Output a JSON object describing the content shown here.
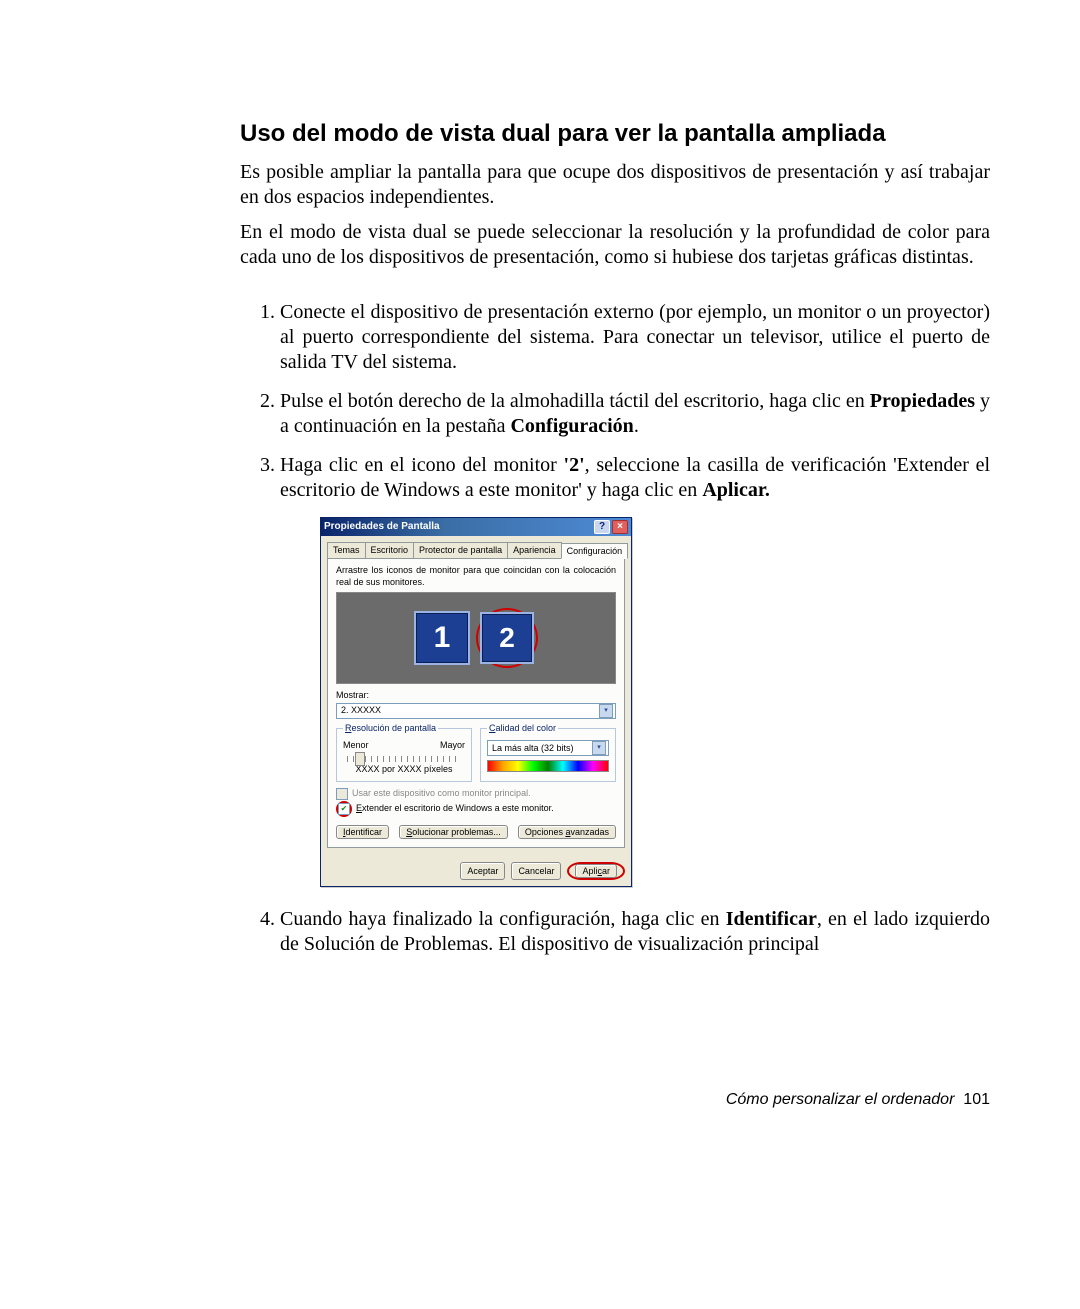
{
  "section_title": "Uso del modo de vista dual para ver la pantalla ampliada",
  "intro_p1": "Es posible ampliar la pantalla para que ocupe dos dispositivos de presentación y así trabajar en dos espacios independientes.",
  "intro_p2": "En el modo de vista dual se puede seleccionar la resolución y la profundidad de color para cada uno de los dispositivos de presentación, como si hubiese dos tarjetas gráficas distintas.",
  "steps": {
    "s1": "Conecte el dispositivo de presentación externo (por ejemplo, un monitor o un proyector) al puerto correspondiente del sistema. Para conectar un televisor, utilice el puerto de salida TV del sistema.",
    "s2_a": "Pulse el botón derecho de la almohadilla táctil del escritorio, haga clic en ",
    "s2_b1": "Propiedades",
    "s2_c": " y a continuación en la pestaña ",
    "s2_b2": "Configuración",
    "s2_d": ".",
    "s3_a": "Haga clic en el icono del monitor ",
    "s3_b1": "'2'",
    "s3_c": ", seleccione la casilla de verificación 'Extender el escritorio de Windows a este monitor' y haga clic en ",
    "s3_b2": "Aplicar.",
    "s4_a": "Cuando haya finalizado la configuración, haga clic en ",
    "s4_b1": "Identificar",
    "s4_c": ", en el lado izquierdo de Solución de Problemas. El dispositivo de visualización principal"
  },
  "dialog": {
    "title": "Propiedades de Pantalla",
    "help": "?",
    "close": "×",
    "tabs": [
      "Temas",
      "Escritorio",
      "Protector de pantalla",
      "Apariencia",
      "Configuración"
    ],
    "active_tab_index": 4,
    "hint": "Arrastre los iconos de monitor para que coincidan con la colocación real de sus monitores.",
    "monitor1": "1",
    "monitor2": "2",
    "mostrar_label": "Mostrar:",
    "mostrar_value": "2. XXXXX",
    "res_legend": "Resolución de pantalla",
    "res_min": "Menor",
    "res_max": "Mayor",
    "res_value": "XXXX por XXXX píxeles",
    "color_legend": "Calidad del color",
    "color_value": "La más alta (32 bits)",
    "check_primary": "Usar este dispositivo como monitor principal.",
    "check_extend": "Extender el escritorio de Windows a este monitor.",
    "btn_identify": "Identificar",
    "btn_troubleshoot": "Solucionar problemas...",
    "btn_advanced": "Opciones avanzadas",
    "btn_ok": "Aceptar",
    "btn_cancel": "Cancelar",
    "btn_apply": "Aplicar"
  },
  "footer_text": "Cómo personalizar el ordenador",
  "footer_page": "101"
}
